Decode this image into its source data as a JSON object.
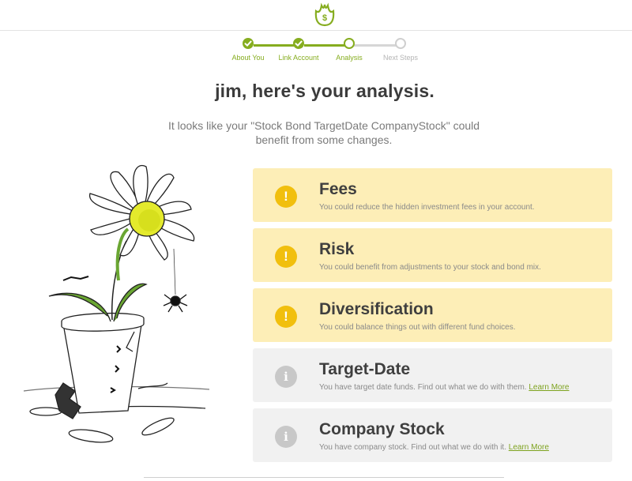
{
  "colors": {
    "accent": "#86ad1f",
    "pending": "#d6d6d6",
    "warn_card": "#fdeeb7",
    "warn_icon": "#f1bf0e",
    "info_card": "#f1f1f1",
    "info_icon": "#c8c8c8"
  },
  "header": {
    "logo_icon": "tulip-dollar-icon"
  },
  "steps": [
    {
      "label": "About You",
      "state": "done"
    },
    {
      "label": "Link Account",
      "state": "done"
    },
    {
      "label": "Analysis",
      "state": "current"
    },
    {
      "label": "Next Steps",
      "state": "pending"
    }
  ],
  "main": {
    "headline": "jim, here's your analysis.",
    "subline": "It looks like your \"Stock Bond TargetDate CompanyStock\" could benefit from some changes."
  },
  "cards": [
    {
      "kind": "warn",
      "icon": "exclamation-icon",
      "glyph": "!",
      "title": "Fees",
      "desc": "You could reduce the hidden investment fees in your account."
    },
    {
      "kind": "warn",
      "icon": "exclamation-icon",
      "glyph": "!",
      "title": "Risk",
      "desc": "You could benefit from adjustments to your stock and bond mix."
    },
    {
      "kind": "warn",
      "icon": "exclamation-icon",
      "glyph": "!",
      "title": "Diversification",
      "desc": "You could balance things out with different fund choices."
    },
    {
      "kind": "info",
      "icon": "info-icon",
      "glyph": "i",
      "title": "Target-Date",
      "desc": "You have target date funds. Find out what we do with them.",
      "link": "Learn More"
    },
    {
      "kind": "info",
      "icon": "info-icon",
      "glyph": "i",
      "title": "Company Stock",
      "desc": "You have company stock. Find out what we do with it.",
      "link": "Learn More"
    }
  ],
  "illustration": {
    "icon": "wilting-daisy-illustration"
  }
}
